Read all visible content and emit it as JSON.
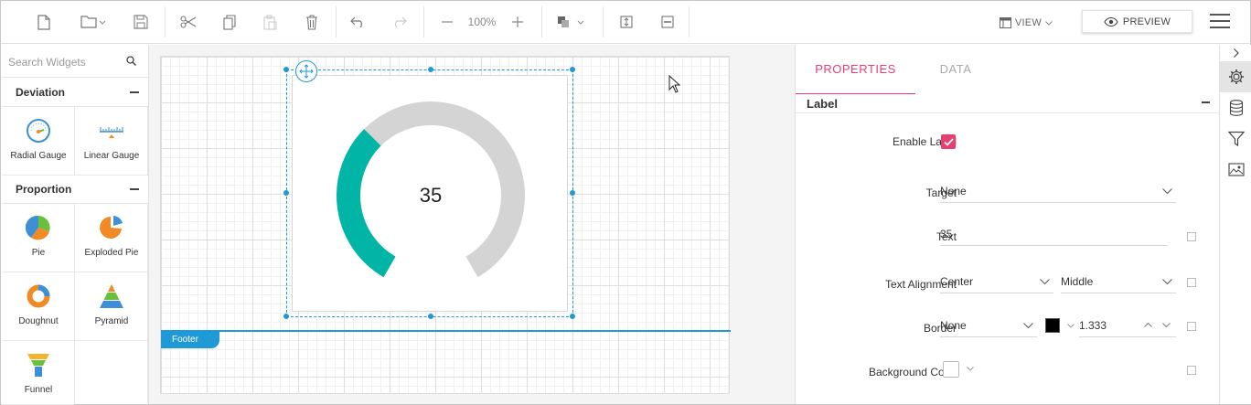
{
  "toolbar": {
    "zoom": "100%",
    "view_label": "VIEW",
    "preview_label": "PREVIEW"
  },
  "widgets": {
    "search_placeholder": "Search Widgets",
    "categories": [
      {
        "name": "Deviation",
        "items": [
          "Radial Gauge",
          "Linear Gauge"
        ]
      },
      {
        "name": "Proportion",
        "items": [
          "Pie",
          "Exploded Pie",
          "Doughnut",
          "Pyramid",
          "Funnel"
        ]
      }
    ]
  },
  "canvas": {
    "footer_label": "Footer",
    "gauge_value": "35",
    "gauge_fraction": 0.35,
    "gauge_fill_color": "#00b5a5",
    "gauge_track_color": "#d4d4d4"
  },
  "properties": {
    "tabs": [
      "PROPERTIES",
      "DATA"
    ],
    "section": "Label",
    "enable_label": {
      "label": "Enable Label",
      "checked": true
    },
    "target": {
      "label": "Target",
      "value": "None"
    },
    "text": {
      "label": "Text",
      "value": "35"
    },
    "text_alignment": {
      "label": "Text Alignment",
      "horizontal": "Center",
      "vertical": "Middle"
    },
    "border": {
      "label": "Border",
      "style": "None",
      "color": "#000000",
      "width": "1.333"
    },
    "background_color": {
      "label": "Background Color"
    }
  },
  "colors": {
    "accent": "#e83e70",
    "selection": "#1f9ad6"
  }
}
